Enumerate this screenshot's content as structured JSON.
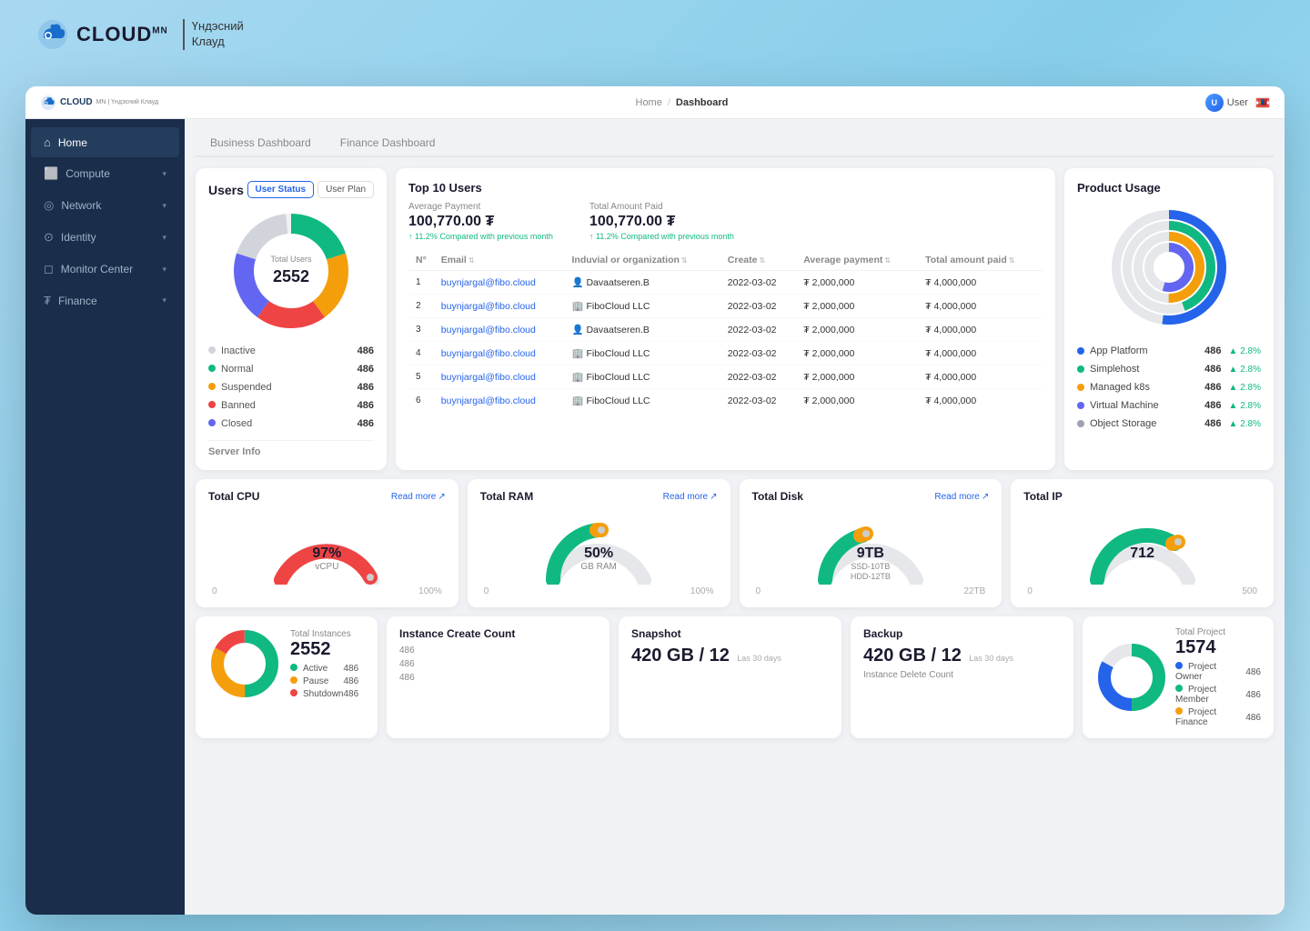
{
  "app": {
    "logo_text": "CLOUD",
    "logo_sub_line1": "Үндэсний",
    "logo_sub_line2": "Клауд",
    "logo_suffix": "MN"
  },
  "topbar": {
    "breadcrumb_home": "Home",
    "breadcrumb_sep": "/",
    "breadcrumb_current": "Dashboard",
    "user_label": "User",
    "mini_logo": "CLOUD"
  },
  "sidebar": {
    "items": [
      {
        "label": "Home",
        "icon": "⌂",
        "active": true
      },
      {
        "label": "Compute",
        "icon": "⬜",
        "active": false,
        "has_chevron": true
      },
      {
        "label": "Network",
        "icon": "◎",
        "active": false,
        "has_chevron": true
      },
      {
        "label": "Identity",
        "icon": "⊙",
        "active": false,
        "has_chevron": true
      },
      {
        "label": "Monitor Center",
        "icon": "◻",
        "active": false,
        "has_chevron": true
      },
      {
        "label": "Finance",
        "icon": "₮",
        "active": false,
        "has_chevron": true
      }
    ]
  },
  "tabs": [
    {
      "label": "Business Dashboard",
      "active": false
    },
    {
      "label": "Finance Dashboard",
      "active": false
    }
  ],
  "users_card": {
    "title": "Users",
    "status_btn": "User Status",
    "plan_btn": "User Plan",
    "donut_label": "Total Users",
    "donut_value": "2552",
    "statuses": [
      {
        "label": "Inactive",
        "count": "486",
        "color": "#e5e7eb"
      },
      {
        "label": "Normal",
        "count": "486",
        "color": "#10b981"
      },
      {
        "label": "Suspended",
        "count": "486",
        "color": "#f59e0b"
      },
      {
        "label": "Banned",
        "count": "486",
        "color": "#ef4444"
      },
      {
        "label": "Closed",
        "count": "486",
        "color": "#6366f1"
      }
    ]
  },
  "top_users": {
    "title": "Top 10 Users",
    "avg_payment_label": "Average Payment",
    "avg_payment_value": "100,770.00 ₮",
    "total_payment_label": "Total Amount Paid",
    "total_payment_value": "100,770.00 ₮",
    "avg_change": "↑ 11.2% Compared with previous month",
    "total_change": "↑ 11.2% Compared with previous month",
    "table_headers": [
      "N°",
      "Email",
      "Induvial or organization",
      "Create",
      "Average payment",
      "Total amount paid"
    ],
    "rows": [
      {
        "n": "1",
        "email": "buynjargal@fibo.cloud",
        "org": "Davaatseren.B",
        "org_type": "person",
        "create": "2022-03-02",
        "avg": "₮ 2,000,000",
        "total": "₮ 4,000,000"
      },
      {
        "n": "2",
        "email": "buynjargal@fibo.cloud",
        "org": "FiboCloud LLC",
        "org_type": "org",
        "create": "2022-03-02",
        "avg": "₮ 2,000,000",
        "total": "₮ 4,000,000"
      },
      {
        "n": "3",
        "email": "buynjargal@fibo.cloud",
        "org": "Davaatseren.B",
        "org_type": "person",
        "create": "2022-03-02",
        "avg": "₮ 2,000,000",
        "total": "₮ 4,000,000"
      },
      {
        "n": "4",
        "email": "buynjargal@fibo.cloud",
        "org": "FiboCloud LLC",
        "org_type": "org",
        "create": "2022-03-02",
        "avg": "₮ 2,000,000",
        "total": "₮ 4,000,000"
      },
      {
        "n": "5",
        "email": "buynjargal@fibo.cloud",
        "org": "FiboCloud LLC",
        "org_type": "org",
        "create": "2022-03-02",
        "avg": "₮ 2,000,000",
        "total": "₮ 4,000,000"
      },
      {
        "n": "6",
        "email": "buynjargal@fibo.cloud",
        "org": "FiboCloud LLC",
        "org_type": "org",
        "create": "2022-03-02",
        "avg": "₮ 2,000,000",
        "total": "₮ 4,000,000"
      }
    ]
  },
  "product_usage": {
    "title": "Product Usage",
    "items": [
      {
        "name": "App Platform",
        "count": "486",
        "change": "▲ 2.8%",
        "color": "#2563eb"
      },
      {
        "name": "Simplehost",
        "count": "486",
        "change": "▲ 2.8%",
        "color": "#10b981"
      },
      {
        "name": "Managed k8s",
        "count": "486",
        "change": "▲ 2.8%",
        "color": "#f59e0b"
      },
      {
        "name": "Virtual Machine",
        "count": "486",
        "change": "▲ 2.8%",
        "color": "#6366f1"
      },
      {
        "name": "Object Storage",
        "count": "486",
        "change": "▲ 2.8%",
        "color": "#9ca3af"
      }
    ],
    "donut_colors": [
      "#2563eb",
      "#10b981",
      "#f59e0b",
      "#6366f1",
      "#e5e7eb"
    ]
  },
  "server_info_label": "Server Info",
  "cpu": {
    "title": "Total CPU",
    "read_more": "Read more",
    "value": "97%",
    "unit": "vCPU",
    "min": "0",
    "max": "100%",
    "percent": 97,
    "color_fill": "#ef4444",
    "color_bg": "#e5e7eb"
  },
  "ram": {
    "title": "Total RAM",
    "read_more": "Read more",
    "value": "50%",
    "unit": "GB RAM",
    "min": "0",
    "max": "100%",
    "percent": 50,
    "color_fill": "#10b981",
    "color_bg": "#e5e7eb"
  },
  "disk": {
    "title": "Total Disk",
    "read_more": "Read more",
    "value": "9TB",
    "unit_line1": "SSD-10TB",
    "unit_line2": "HDD-12TB",
    "min": "0",
    "max": "22TB",
    "percent": 41,
    "color_fill": "#10b981",
    "color_bg": "#e5e7eb"
  },
  "ip": {
    "title": "Total IP",
    "value": "712",
    "min": "0",
    "max": "500",
    "percent": 71,
    "color_fill": "#10b981",
    "color_bg": "#e5e7eb"
  },
  "instances": {
    "title": "Total Instances",
    "value": "2552",
    "statuses": [
      {
        "label": "Active",
        "count": "486",
        "color": "#10b981"
      },
      {
        "label": "Pause",
        "count": "486",
        "color": "#f59e0b"
      },
      {
        "label": "Shutdown",
        "count": "486",
        "color": "#ef4444"
      }
    ]
  },
  "snapshot": {
    "title": "Snapshot",
    "value": "420 GB / 12",
    "period": "Las 30 days"
  },
  "backup": {
    "title": "Backup",
    "value": "420 GB / 12",
    "period": "Las 30 days",
    "sub_label": "Instance Delete Count"
  },
  "instance_create": {
    "label": "Instance Create Count"
  },
  "project": {
    "title": "Total Project",
    "value": "1574",
    "items": [
      {
        "label": "Project Owner",
        "count": "486",
        "color": "#2563eb"
      },
      {
        "label": "Project Member",
        "count": "486",
        "color": "#10b981"
      },
      {
        "label": "Project Finance",
        "count": "486",
        "color": "#f59e0b"
      }
    ]
  }
}
